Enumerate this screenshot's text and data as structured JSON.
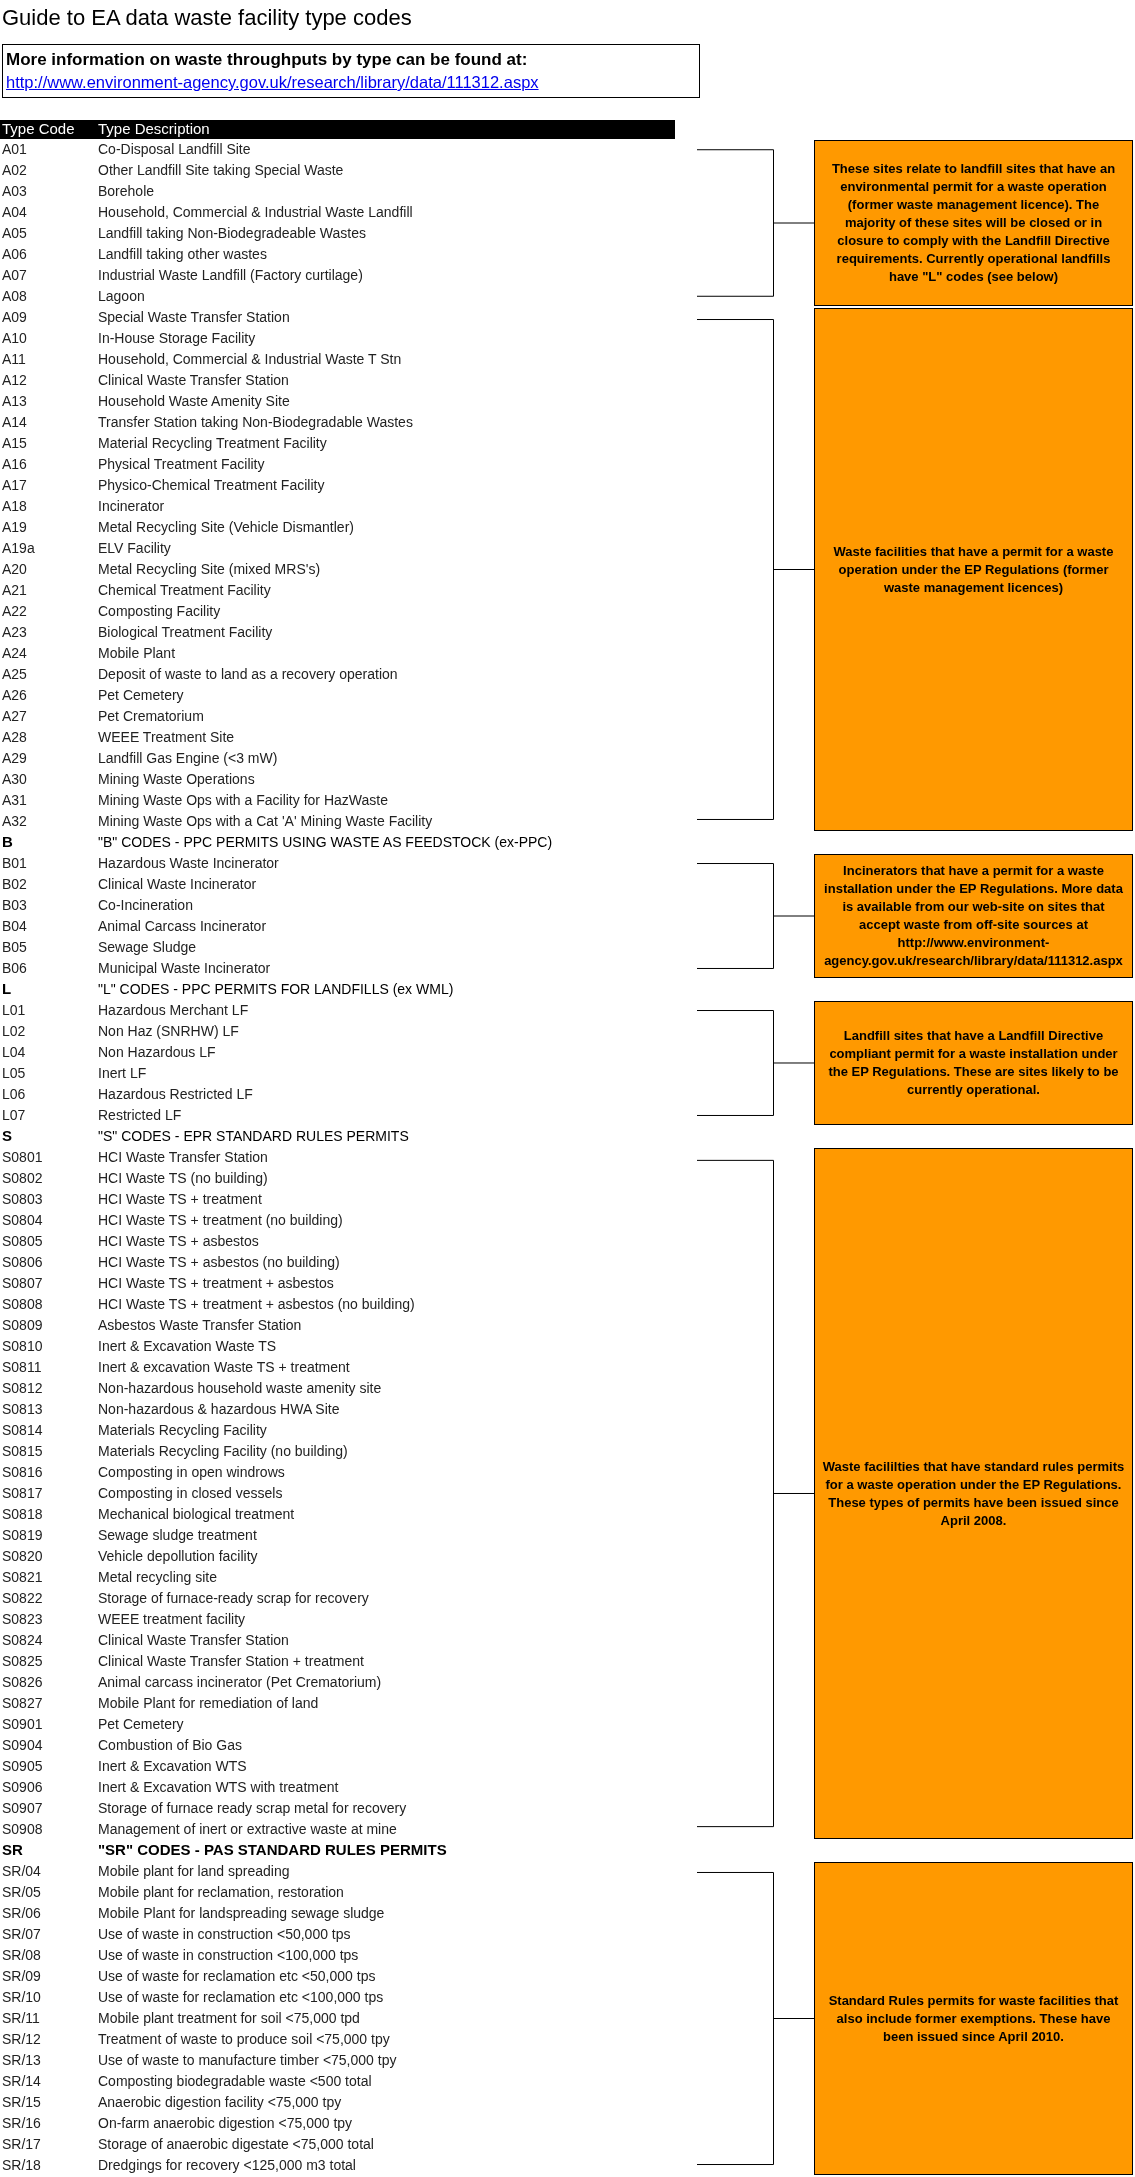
{
  "title": "Guide to EA data waste facility type codes",
  "info_box": {
    "text": "More information on waste throughputs by type can be found at:",
    "link": "http://www.environment-agency.gov.uk/research/library/data/111312.aspx"
  },
  "table": {
    "columns": [
      "Type Code",
      "Type Description"
    ],
    "blocks": [
      {
        "kind": "group",
        "note": "These sites relate to landfill sites that have an environmental permit for a waste operation (former waste management licence).  The majority of these sites will be closed or in closure to comply with the Landfill Directive requirements.  Currently operational landfills have \"L\" codes (see below)",
        "rows": [
          [
            "A01",
            "Co-Disposal Landfill Site"
          ],
          [
            "A02",
            "Other Landfill Site taking Special Waste"
          ],
          [
            "A03",
            "Borehole"
          ],
          [
            "A04",
            "Household, Commercial & Industrial Waste Landfill"
          ],
          [
            "A05",
            "Landfill taking Non-Biodegradeable Wastes"
          ],
          [
            "A06",
            "Landfill taking other wastes"
          ],
          [
            "A07",
            "Industrial Waste Landfill (Factory curtilage)"
          ],
          [
            "A08",
            "Lagoon"
          ]
        ]
      },
      {
        "kind": "group",
        "note": "Waste facilities that have a permit for a waste operation under the EP Regulations (former waste management licences)",
        "rows": [
          [
            "A09",
            "Special Waste Transfer Station"
          ],
          [
            "A10",
            "In-House Storage Facility"
          ],
          [
            "A11",
            "Household, Commercial & Industrial  Waste T Stn"
          ],
          [
            "A12",
            "Clinical Waste Transfer Station"
          ],
          [
            "A13",
            "Household Waste Amenity Site"
          ],
          [
            "A14",
            "Transfer Station taking Non-Biodegradable Wastes"
          ],
          [
            "A15",
            "Material Recycling Treatment Facility"
          ],
          [
            "A16",
            "Physical Treatment Facility"
          ],
          [
            "A17",
            "Physico-Chemical Treatment Facility"
          ],
          [
            "A18",
            "Incinerator"
          ],
          [
            "A19",
            "Metal Recycling Site (Vehicle Dismantler)"
          ],
          [
            "A19a",
            "ELV Facility"
          ],
          [
            "A20",
            "Metal Recycling Site (mixed MRS's)"
          ],
          [
            "A21",
            "Chemical Treatment Facility"
          ],
          [
            "A22",
            "Composting Facility"
          ],
          [
            "A23",
            "Biological Treatment Facility"
          ],
          [
            "A24",
            "Mobile Plant"
          ],
          [
            "A25",
            "Deposit of waste to land as a recovery operation"
          ],
          [
            "A26",
            "Pet Cemetery"
          ],
          [
            "A27",
            "Pet Crematorium"
          ],
          [
            "A28",
            "WEEE Treatment Site"
          ],
          [
            "A29",
            "Landfill Gas Engine (<3 mW)"
          ],
          [
            "A30",
            "Mining Waste Operations"
          ],
          [
            "A31",
            "Mining Waste Ops with a Facility for HazWaste"
          ],
          [
            "A32",
            "Mining Waste Ops with a Cat 'A' Mining Waste Facility"
          ]
        ]
      },
      {
        "kind": "heading",
        "code": "B",
        "description": "\"B\" CODES - PPC PERMITS USING WASTE AS FEEDSTOCK (ex-PPC)",
        "bold_description": false
      },
      {
        "kind": "group",
        "note": "Incinerators that have a permit for a waste installation under the EP Regulations. More data is available from our web-site on sites that accept waste from off-site sources at http://www.environment-agency.gov.uk/research/library/data/111312.aspx",
        "rows": [
          [
            "B01",
            "Hazardous Waste Incinerator"
          ],
          [
            "B02",
            "Clinical Waste Incinerator"
          ],
          [
            "B03",
            "Co-Incineration"
          ],
          [
            "B04",
            "Animal Carcass Incinerator"
          ],
          [
            "B05",
            "Sewage Sludge"
          ],
          [
            "B06",
            "Municipal Waste Incinerator"
          ]
        ]
      },
      {
        "kind": "heading",
        "code": "L",
        "description": "\"L\"  CODES - PPC PERMITS FOR LANDFILLS (ex WML)",
        "bold_description": false
      },
      {
        "kind": "group",
        "note": "Landfill sites that have a Landfill Directive compliant permit for a waste installation under the EP Regulations.  These are sites likely to be currently operational.",
        "rows": [
          [
            "L01",
            "Hazardous Merchant LF"
          ],
          [
            "L02",
            "Non Haz (SNRHW) LF"
          ],
          [
            "L04",
            "Non Hazardous LF"
          ],
          [
            "L05",
            "Inert LF"
          ],
          [
            "L06",
            "Hazardous Restricted LF"
          ],
          [
            "L07",
            "Restricted LF"
          ]
        ]
      },
      {
        "kind": "heading",
        "code": "S",
        "description": "\"S\"  CODES - EPR STANDARD RULES PERMITS",
        "bold_description": false
      },
      {
        "kind": "group",
        "note": "Waste facililties that have standard rules permits for a waste operation under the EP Regulations.  These types of permits have been issued since April 2008.",
        "rows": [
          [
            "S0801",
            "HCI Waste Transfer Station"
          ],
          [
            "S0802",
            "HCI Waste TS (no building)"
          ],
          [
            "S0803",
            "HCI Waste TS + treatment"
          ],
          [
            "S0804",
            "HCI Waste TS + treatment (no building)"
          ],
          [
            "S0805",
            "HCI Waste TS + asbestos"
          ],
          [
            "S0806",
            "HCI Waste TS + asbestos (no building)"
          ],
          [
            "S0807",
            "HCI Waste TS + treatment + asbestos"
          ],
          [
            "S0808",
            "HCI Waste TS + treatment + asbestos (no building)"
          ],
          [
            "S0809",
            "Asbestos Waste Transfer Station"
          ],
          [
            "S0810",
            "Inert & Excavation Waste TS"
          ],
          [
            "S0811",
            "Inert & excavation Waste TS + treatment"
          ],
          [
            "S0812",
            "Non-hazardous household waste amenity site"
          ],
          [
            "S0813",
            "Non-hazardous & hazardous HWA Site"
          ],
          [
            "S0814",
            "Materials Recycling Facility"
          ],
          [
            "S0815",
            "Materials Recycling Facility (no building)"
          ],
          [
            "S0816",
            "Composting in open windrows"
          ],
          [
            "S0817",
            "Composting in closed vessels"
          ],
          [
            "S0818",
            "Mechanical biological treatment"
          ],
          [
            "S0819",
            "Sewage sludge treatment"
          ],
          [
            "S0820",
            "Vehicle depollution facility"
          ],
          [
            "S0821",
            "Metal recycling site"
          ],
          [
            "S0822",
            "Storage of furnace-ready scrap for recovery"
          ],
          [
            "S0823",
            "WEEE treatment facility"
          ],
          [
            "S0824",
            "Clinical Waste Transfer Station"
          ],
          [
            "S0825",
            "Clinical Waste Transfer Station + treatment"
          ],
          [
            "S0826",
            "Animal carcass incinerator (Pet Crematorium)"
          ],
          [
            "S0827",
            "Mobile Plant for remediation of land"
          ],
          [
            "S0901",
            "Pet Cemetery"
          ],
          [
            "S0904",
            "Combustion of Bio Gas"
          ],
          [
            "S0905",
            "Inert & Excavation WTS"
          ],
          [
            "S0906",
            "Inert & Excavation WTS with treatment"
          ],
          [
            "S0907",
            "Storage of furnace ready scrap metal for recovery"
          ],
          [
            "S0908",
            "Management of inert or extractive waste at mine"
          ]
        ]
      },
      {
        "kind": "heading",
        "code": "SR",
        "description": "\"SR\" CODES - PAS STANDARD RULES PERMITS",
        "bold_description": true
      },
      {
        "kind": "group",
        "note": "Standard Rules permits for waste facilities that also include former exemptions.  These have been issued since April 2010.",
        "rows": [
          [
            "SR/04",
            "Mobile plant for land spreading"
          ],
          [
            "SR/05",
            "Mobile plant for reclamation, restoration"
          ],
          [
            "SR/06",
            "Mobile Plant for landspreading sewage sludge"
          ],
          [
            "SR/07",
            "Use of waste in construction <50,000 tps"
          ],
          [
            "SR/08",
            "Use of waste in construction <100,000 tps"
          ],
          [
            "SR/09",
            "Use of waste for reclamation etc <50,000 tps"
          ],
          [
            "SR/10",
            "Use of waste for reclamation etc <100,000 tps"
          ],
          [
            "SR/11",
            "Mobile plant treatment for soil <75,000 tpd"
          ],
          [
            "SR/12",
            "Treatment of waste to produce soil <75,000 tpy"
          ],
          [
            "SR/13",
            "Use of waste to manufacture timber <75,000 tpy"
          ],
          [
            "SR/14",
            "Composting biodegradable waste <500 total"
          ],
          [
            "SR/15",
            "Anaerobic digestion facility <75,000 tpy"
          ],
          [
            "SR/16",
            "On-farm anaerobic digestion <75,000 tpy"
          ],
          [
            "SR/17",
            "Storage of anaerobic digestate <75,000 total"
          ],
          [
            "SR/18",
            "Dredgings for recovery <125,000 m3 total"
          ]
        ]
      }
    ]
  }
}
